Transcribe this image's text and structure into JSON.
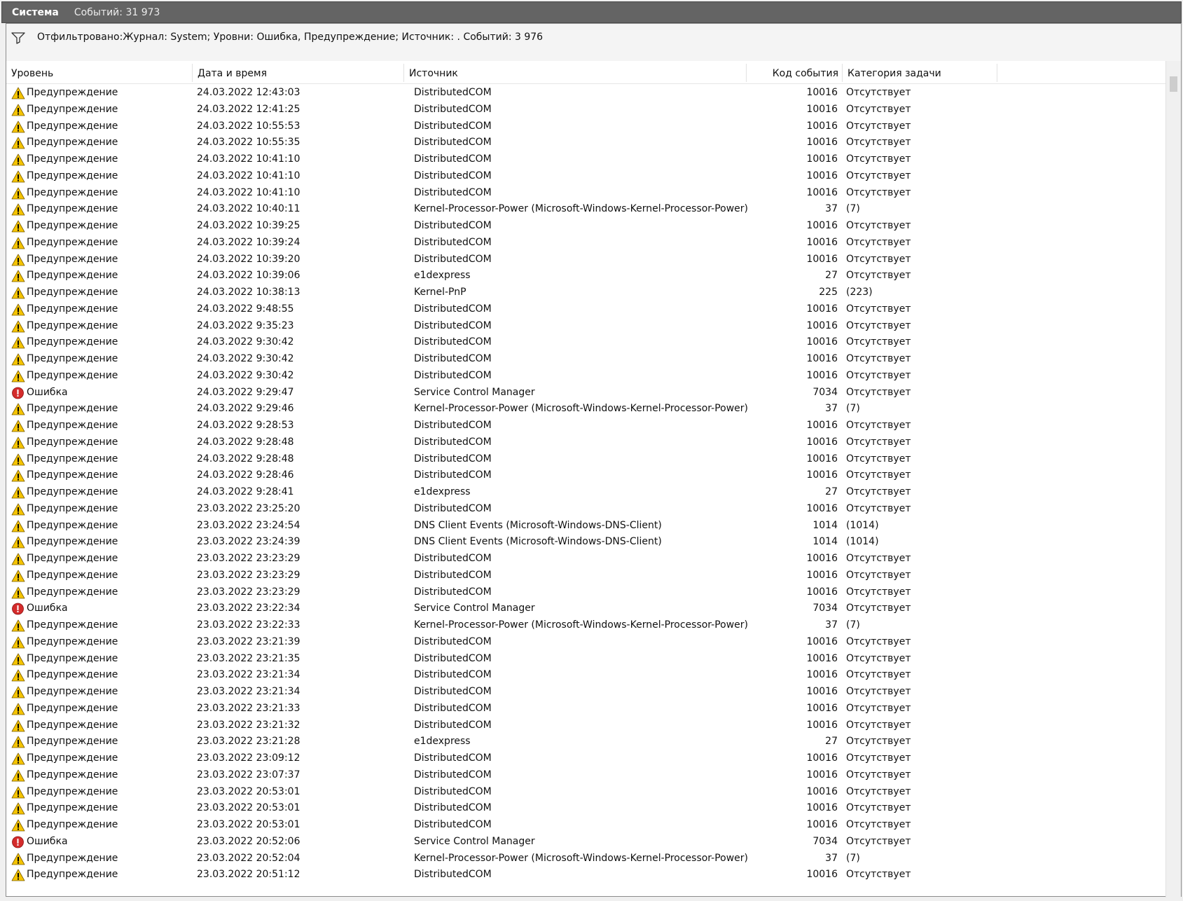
{
  "window": {
    "title": "Система",
    "event_count": "Событий: 31 973"
  },
  "filter": {
    "icon": "funnel-icon",
    "text": "Отфильтровано:Журнал: System; Уровни: Ошибка, Предупреждение; Источник: . Событий: 3 976"
  },
  "columns": {
    "level": "Уровень",
    "datetime": "Дата и время",
    "source": "Источник",
    "event_id": "Код события",
    "task_category": "Категория задачи"
  },
  "level_icons": {
    "warning": "warning-icon",
    "error": "error-icon"
  },
  "colors": {
    "warning": "#f5c400",
    "error": "#d42b2b",
    "titlebar": "#646464"
  },
  "rows": [
    {
      "type": "warning",
      "level": "Предупреждение",
      "datetime": "24.03.2022 12:43:03",
      "source": "DistributedCOM",
      "event_id": "10016",
      "category": "Отсутствует"
    },
    {
      "type": "warning",
      "level": "Предупреждение",
      "datetime": "24.03.2022 12:41:25",
      "source": "DistributedCOM",
      "event_id": "10016",
      "category": "Отсутствует"
    },
    {
      "type": "warning",
      "level": "Предупреждение",
      "datetime": "24.03.2022 10:55:53",
      "source": "DistributedCOM",
      "event_id": "10016",
      "category": "Отсутствует"
    },
    {
      "type": "warning",
      "level": "Предупреждение",
      "datetime": "24.03.2022 10:55:35",
      "source": "DistributedCOM",
      "event_id": "10016",
      "category": "Отсутствует"
    },
    {
      "type": "warning",
      "level": "Предупреждение",
      "datetime": "24.03.2022 10:41:10",
      "source": "DistributedCOM",
      "event_id": "10016",
      "category": "Отсутствует"
    },
    {
      "type": "warning",
      "level": "Предупреждение",
      "datetime": "24.03.2022 10:41:10",
      "source": "DistributedCOM",
      "event_id": "10016",
      "category": "Отсутствует"
    },
    {
      "type": "warning",
      "level": "Предупреждение",
      "datetime": "24.03.2022 10:41:10",
      "source": "DistributedCOM",
      "event_id": "10016",
      "category": "Отсутствует"
    },
    {
      "type": "warning",
      "level": "Предупреждение",
      "datetime": "24.03.2022 10:40:11",
      "source": "Kernel-Processor-Power (Microsoft-Windows-Kernel-Processor-Power)",
      "event_id": "37",
      "category": "(7)"
    },
    {
      "type": "warning",
      "level": "Предупреждение",
      "datetime": "24.03.2022 10:39:25",
      "source": "DistributedCOM",
      "event_id": "10016",
      "category": "Отсутствует"
    },
    {
      "type": "warning",
      "level": "Предупреждение",
      "datetime": "24.03.2022 10:39:24",
      "source": "DistributedCOM",
      "event_id": "10016",
      "category": "Отсутствует"
    },
    {
      "type": "warning",
      "level": "Предупреждение",
      "datetime": "24.03.2022 10:39:20",
      "source": "DistributedCOM",
      "event_id": "10016",
      "category": "Отсутствует"
    },
    {
      "type": "warning",
      "level": "Предупреждение",
      "datetime": "24.03.2022 10:39:06",
      "source": "e1dexpress",
      "event_id": "27",
      "category": "Отсутствует"
    },
    {
      "type": "warning",
      "level": "Предупреждение",
      "datetime": "24.03.2022 10:38:13",
      "source": "Kernel-PnP",
      "event_id": "225",
      "category": "(223)"
    },
    {
      "type": "warning",
      "level": "Предупреждение",
      "datetime": "24.03.2022 9:48:55",
      "source": "DistributedCOM",
      "event_id": "10016",
      "category": "Отсутствует"
    },
    {
      "type": "warning",
      "level": "Предупреждение",
      "datetime": "24.03.2022 9:35:23",
      "source": "DistributedCOM",
      "event_id": "10016",
      "category": "Отсутствует"
    },
    {
      "type": "warning",
      "level": "Предупреждение",
      "datetime": "24.03.2022 9:30:42",
      "source": "DistributedCOM",
      "event_id": "10016",
      "category": "Отсутствует"
    },
    {
      "type": "warning",
      "level": "Предупреждение",
      "datetime": "24.03.2022 9:30:42",
      "source": "DistributedCOM",
      "event_id": "10016",
      "category": "Отсутствует"
    },
    {
      "type": "warning",
      "level": "Предупреждение",
      "datetime": "24.03.2022 9:30:42",
      "source": "DistributedCOM",
      "event_id": "10016",
      "category": "Отсутствует"
    },
    {
      "type": "error",
      "level": "Ошибка",
      "datetime": "24.03.2022 9:29:47",
      "source": "Service Control Manager",
      "event_id": "7034",
      "category": "Отсутствует"
    },
    {
      "type": "warning",
      "level": "Предупреждение",
      "datetime": "24.03.2022 9:29:46",
      "source": "Kernel-Processor-Power (Microsoft-Windows-Kernel-Processor-Power)",
      "event_id": "37",
      "category": "(7)"
    },
    {
      "type": "warning",
      "level": "Предупреждение",
      "datetime": "24.03.2022 9:28:53",
      "source": "DistributedCOM",
      "event_id": "10016",
      "category": "Отсутствует"
    },
    {
      "type": "warning",
      "level": "Предупреждение",
      "datetime": "24.03.2022 9:28:48",
      "source": "DistributedCOM",
      "event_id": "10016",
      "category": "Отсутствует"
    },
    {
      "type": "warning",
      "level": "Предупреждение",
      "datetime": "24.03.2022 9:28:48",
      "source": "DistributedCOM",
      "event_id": "10016",
      "category": "Отсутствует"
    },
    {
      "type": "warning",
      "level": "Предупреждение",
      "datetime": "24.03.2022 9:28:46",
      "source": "DistributedCOM",
      "event_id": "10016",
      "category": "Отсутствует"
    },
    {
      "type": "warning",
      "level": "Предупреждение",
      "datetime": "24.03.2022 9:28:41",
      "source": "e1dexpress",
      "event_id": "27",
      "category": "Отсутствует"
    },
    {
      "type": "warning",
      "level": "Предупреждение",
      "datetime": "23.03.2022 23:25:20",
      "source": "DistributedCOM",
      "event_id": "10016",
      "category": "Отсутствует"
    },
    {
      "type": "warning",
      "level": "Предупреждение",
      "datetime": "23.03.2022 23:24:54",
      "source": "DNS Client Events (Microsoft-Windows-DNS-Client)",
      "event_id": "1014",
      "category": "(1014)"
    },
    {
      "type": "warning",
      "level": "Предупреждение",
      "datetime": "23.03.2022 23:24:39",
      "source": "DNS Client Events (Microsoft-Windows-DNS-Client)",
      "event_id": "1014",
      "category": "(1014)"
    },
    {
      "type": "warning",
      "level": "Предупреждение",
      "datetime": "23.03.2022 23:23:29",
      "source": "DistributedCOM",
      "event_id": "10016",
      "category": "Отсутствует"
    },
    {
      "type": "warning",
      "level": "Предупреждение",
      "datetime": "23.03.2022 23:23:29",
      "source": "DistributedCOM",
      "event_id": "10016",
      "category": "Отсутствует"
    },
    {
      "type": "warning",
      "level": "Предупреждение",
      "datetime": "23.03.2022 23:23:29",
      "source": "DistributedCOM",
      "event_id": "10016",
      "category": "Отсутствует"
    },
    {
      "type": "error",
      "level": "Ошибка",
      "datetime": "23.03.2022 23:22:34",
      "source": "Service Control Manager",
      "event_id": "7034",
      "category": "Отсутствует"
    },
    {
      "type": "warning",
      "level": "Предупреждение",
      "datetime": "23.03.2022 23:22:33",
      "source": "Kernel-Processor-Power (Microsoft-Windows-Kernel-Processor-Power)",
      "event_id": "37",
      "category": "(7)"
    },
    {
      "type": "warning",
      "level": "Предупреждение",
      "datetime": "23.03.2022 23:21:39",
      "source": "DistributedCOM",
      "event_id": "10016",
      "category": "Отсутствует"
    },
    {
      "type": "warning",
      "level": "Предупреждение",
      "datetime": "23.03.2022 23:21:35",
      "source": "DistributedCOM",
      "event_id": "10016",
      "category": "Отсутствует"
    },
    {
      "type": "warning",
      "level": "Предупреждение",
      "datetime": "23.03.2022 23:21:34",
      "source": "DistributedCOM",
      "event_id": "10016",
      "category": "Отсутствует"
    },
    {
      "type": "warning",
      "level": "Предупреждение",
      "datetime": "23.03.2022 23:21:34",
      "source": "DistributedCOM",
      "event_id": "10016",
      "category": "Отсутствует"
    },
    {
      "type": "warning",
      "level": "Предупреждение",
      "datetime": "23.03.2022 23:21:33",
      "source": "DistributedCOM",
      "event_id": "10016",
      "category": "Отсутствует"
    },
    {
      "type": "warning",
      "level": "Предупреждение",
      "datetime": "23.03.2022 23:21:32",
      "source": "DistributedCOM",
      "event_id": "10016",
      "category": "Отсутствует"
    },
    {
      "type": "warning",
      "level": "Предупреждение",
      "datetime": "23.03.2022 23:21:28",
      "source": "e1dexpress",
      "event_id": "27",
      "category": "Отсутствует"
    },
    {
      "type": "warning",
      "level": "Предупреждение",
      "datetime": "23.03.2022 23:09:12",
      "source": "DistributedCOM",
      "event_id": "10016",
      "category": "Отсутствует"
    },
    {
      "type": "warning",
      "level": "Предупреждение",
      "datetime": "23.03.2022 23:07:37",
      "source": "DistributedCOM",
      "event_id": "10016",
      "category": "Отсутствует"
    },
    {
      "type": "warning",
      "level": "Предупреждение",
      "datetime": "23.03.2022 20:53:01",
      "source": "DistributedCOM",
      "event_id": "10016",
      "category": "Отсутствует"
    },
    {
      "type": "warning",
      "level": "Предупреждение",
      "datetime": "23.03.2022 20:53:01",
      "source": "DistributedCOM",
      "event_id": "10016",
      "category": "Отсутствует"
    },
    {
      "type": "warning",
      "level": "Предупреждение",
      "datetime": "23.03.2022 20:53:01",
      "source": "DistributedCOM",
      "event_id": "10016",
      "category": "Отсутствует"
    },
    {
      "type": "error",
      "level": "Ошибка",
      "datetime": "23.03.2022 20:52:06",
      "source": "Service Control Manager",
      "event_id": "7034",
      "category": "Отсутствует"
    },
    {
      "type": "warning",
      "level": "Предупреждение",
      "datetime": "23.03.2022 20:52:04",
      "source": "Kernel-Processor-Power (Microsoft-Windows-Kernel-Processor-Power)",
      "event_id": "37",
      "category": "(7)"
    },
    {
      "type": "warning",
      "level": "Предупреждение",
      "datetime": "23.03.2022 20:51:12",
      "source": "DistributedCOM",
      "event_id": "10016",
      "category": "Отсутствует"
    }
  ]
}
